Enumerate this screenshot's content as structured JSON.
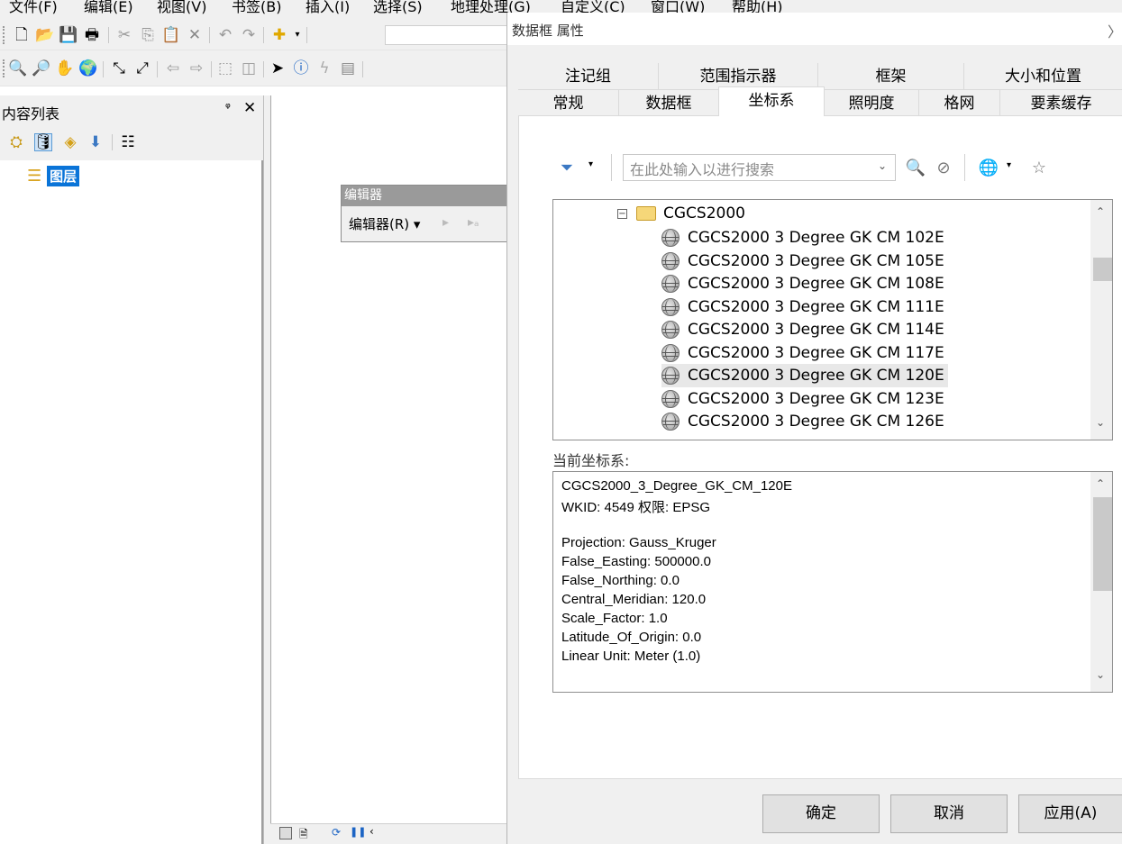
{
  "menu": [
    "文件(F)",
    "编辑(E)",
    "视图(V)",
    "书签(B)",
    "插入(I)",
    "选择(S)",
    "地理处理(G)",
    "自定义(C)",
    "窗口(W)",
    "帮助(H)"
  ],
  "toolbar1_icons": [
    "new-document-icon",
    "open-folder-icon",
    "save-icon",
    "print-icon",
    "cut-icon",
    "copy-icon",
    "paste-icon",
    "delete-icon",
    "undo-icon",
    "redo-icon",
    "add-data-icon"
  ],
  "toolbar2_icons": [
    "zoom-in-icon",
    "zoom-out-icon",
    "pan-icon",
    "full-extent-icon",
    "fixed-zoom-in-icon",
    "fixed-zoom-out-icon",
    "back-icon",
    "forward-icon",
    "select-features-icon",
    "clear-selection-icon",
    "select-elements-icon",
    "identify-icon",
    "hyperlink-icon",
    "html-popup-icon"
  ],
  "toc": {
    "title": "内容列表",
    "pin": "ᵠ",
    "close": "✕",
    "layer_label": "图层"
  },
  "editor": {
    "title": "编辑器",
    "menu": "编辑器(R)"
  },
  "dialog": {
    "title": "数据框 属性",
    "close": "〉",
    "tabs_row1": [
      "注记组",
      "范围指示器",
      "框架",
      "大小和位置"
    ],
    "tabs_row2": [
      "常规",
      "数据框",
      "坐标系",
      "照明度",
      "格网",
      "要素缓存"
    ],
    "active_tab": "坐标系",
    "search_placeholder": "在此处输入以进行搜索",
    "tree_folder": "CGCS2000",
    "tree_items": [
      "CGCS2000 3 Degree GK CM 102E",
      "CGCS2000 3 Degree GK CM 105E",
      "CGCS2000 3 Degree GK CM 108E",
      "CGCS2000 3 Degree GK CM 111E",
      "CGCS2000 3 Degree GK CM 114E",
      "CGCS2000 3 Degree GK CM 117E",
      "CGCS2000 3 Degree GK CM 120E",
      "CGCS2000 3 Degree GK CM 123E",
      "CGCS2000 3 Degree GK CM 126E"
    ],
    "selected_item": "CGCS2000 3 Degree GK CM 120E",
    "current_label": "当前坐标系:",
    "coord_lines": [
      "CGCS2000_3_Degree_GK_CM_120E",
      "WKID: 4549 权限: EPSG",
      "",
      "Projection: Gauss_Kruger",
      "False_Easting: 500000.0",
      "False_Northing: 0.0",
      "Central_Meridian: 120.0",
      "Scale_Factor: 1.0",
      "Latitude_Of_Origin: 0.0",
      "Linear Unit: Meter (1.0)"
    ],
    "buttons": {
      "ok": "确定",
      "cancel": "取消",
      "apply": "应用(A)"
    }
  },
  "colors": {
    "accent": "#0a74d8",
    "panel": "#f0f0f0",
    "button": "#e1e1e1"
  }
}
